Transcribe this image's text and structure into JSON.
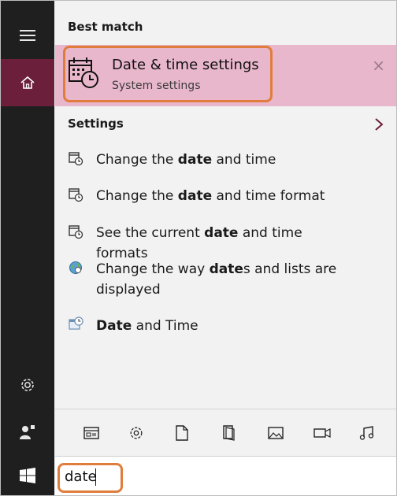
{
  "best_match": {
    "heading": "Best match",
    "title": "Date & time settings",
    "subtitle": "System settings",
    "close_glyph": "×"
  },
  "settings": {
    "heading": "Settings",
    "items": [
      {
        "pre": "Change the ",
        "bold": "date",
        "post": " and time"
      },
      {
        "pre": "Change the ",
        "bold": "date",
        "post": " and time format"
      },
      {
        "pre": "See the current ",
        "bold": "date",
        "post": " and time formats"
      },
      {
        "pre": "Change the way ",
        "bold": "date",
        "post": "s and lists are displayed"
      },
      {
        "pre": "",
        "bold": "Date",
        "post": " and Time"
      }
    ]
  },
  "search": {
    "query": "date"
  },
  "icons": {
    "rail": [
      "hamburger-icon",
      "home-icon",
      "gear-icon",
      "feedback-icon",
      "windows-start-icon"
    ],
    "filters": [
      "apps-filter-icon",
      "settings-filter-icon",
      "documents-filter-icon",
      "folders-filter-icon",
      "photos-filter-icon",
      "videos-filter-icon",
      "music-filter-icon"
    ]
  },
  "colors": {
    "accent": "#6b1f3a",
    "highlight": "#e9b7cc",
    "callout": "#e07d3c",
    "rail": "#1f1f1f"
  }
}
